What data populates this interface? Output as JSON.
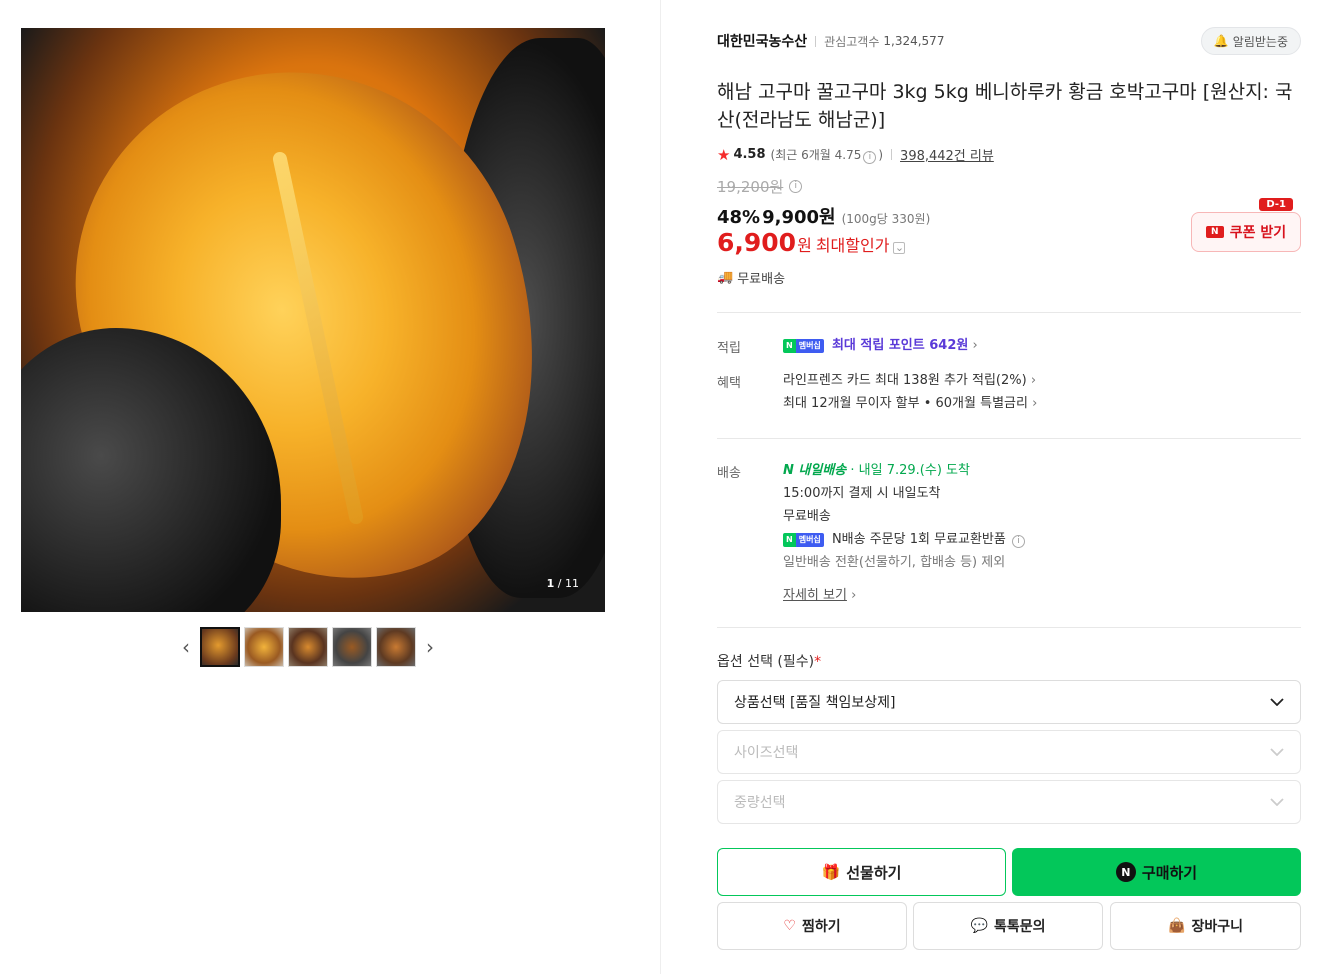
{
  "gallery": {
    "counter_current": "1",
    "counter_total": "/ 11",
    "thumbnails": [
      "thumb-1",
      "thumb-2",
      "thumb-3",
      "thumb-4",
      "thumb-5"
    ]
  },
  "store": {
    "name": "대한민국농수산",
    "fans_label": "관심고객수",
    "fans_count": "1,324,577",
    "alarm_label": "알림받는중"
  },
  "product": {
    "title": "해남 고구마 꿀고구마 3kg 5kg 베니하루카 황금 호박고구마 [원산지: 국산(전라남도 해남군)]",
    "rating": "4.58",
    "rating_recent": "(최근 6개월 4.75",
    "rating_recent_close": ")",
    "review_count": "398,442건 리뷰",
    "original_price": "19,200원",
    "discount": "48%",
    "sale_price": "9,900원",
    "unit_price": "(100g당 330원)",
    "best_price": "6,900",
    "best_price_unit": "원",
    "best_price_label": "최대할인가",
    "free_shipping": "무료배송"
  },
  "coupon": {
    "label": "쿠폰 받기",
    "d_day": "D-1",
    "n_mark": "N"
  },
  "benefits": {
    "points_label": "적립",
    "membership_badge_n": "N",
    "membership_badge_text": "멤버십",
    "points_text": "최대 적립 포인트 642원",
    "benefit_label": "혜택",
    "benefit_line1": "라인프렌즈 카드 최대 138원 추가 적립(2%)",
    "benefit_line2": "최대 12개월 무이자 할부 • 60개월 특별금리"
  },
  "delivery": {
    "label": "배송",
    "tomorrow_badge": "N 내일배송",
    "tomorrow_text": "· 내일 7.29.(수) 도착",
    "cutoff": "15:00까지 결제 시 내일도착",
    "free": "무료배송",
    "return_text": "N배송 주문당 1회 무료교환반품",
    "exclusion": "일반배송 전환(선물하기, 합배송 등) 제외",
    "detail_link": "자세히 보기"
  },
  "options": {
    "label": "옵션 선택 (필수)",
    "required_mark": "*",
    "select1": "상품선택 [품질 책임보상제]",
    "select2": "사이즈선택",
    "select3": "중량선택"
  },
  "actions": {
    "gift": "선물하기",
    "buy": "구매하기",
    "wish": "찜하기",
    "talk": "톡톡문의",
    "cart": "장바구니"
  },
  "colors": {
    "accent_green": "#03c75a",
    "price_red": "#e01d1d",
    "membership_blue": "#3e5cf1"
  }
}
